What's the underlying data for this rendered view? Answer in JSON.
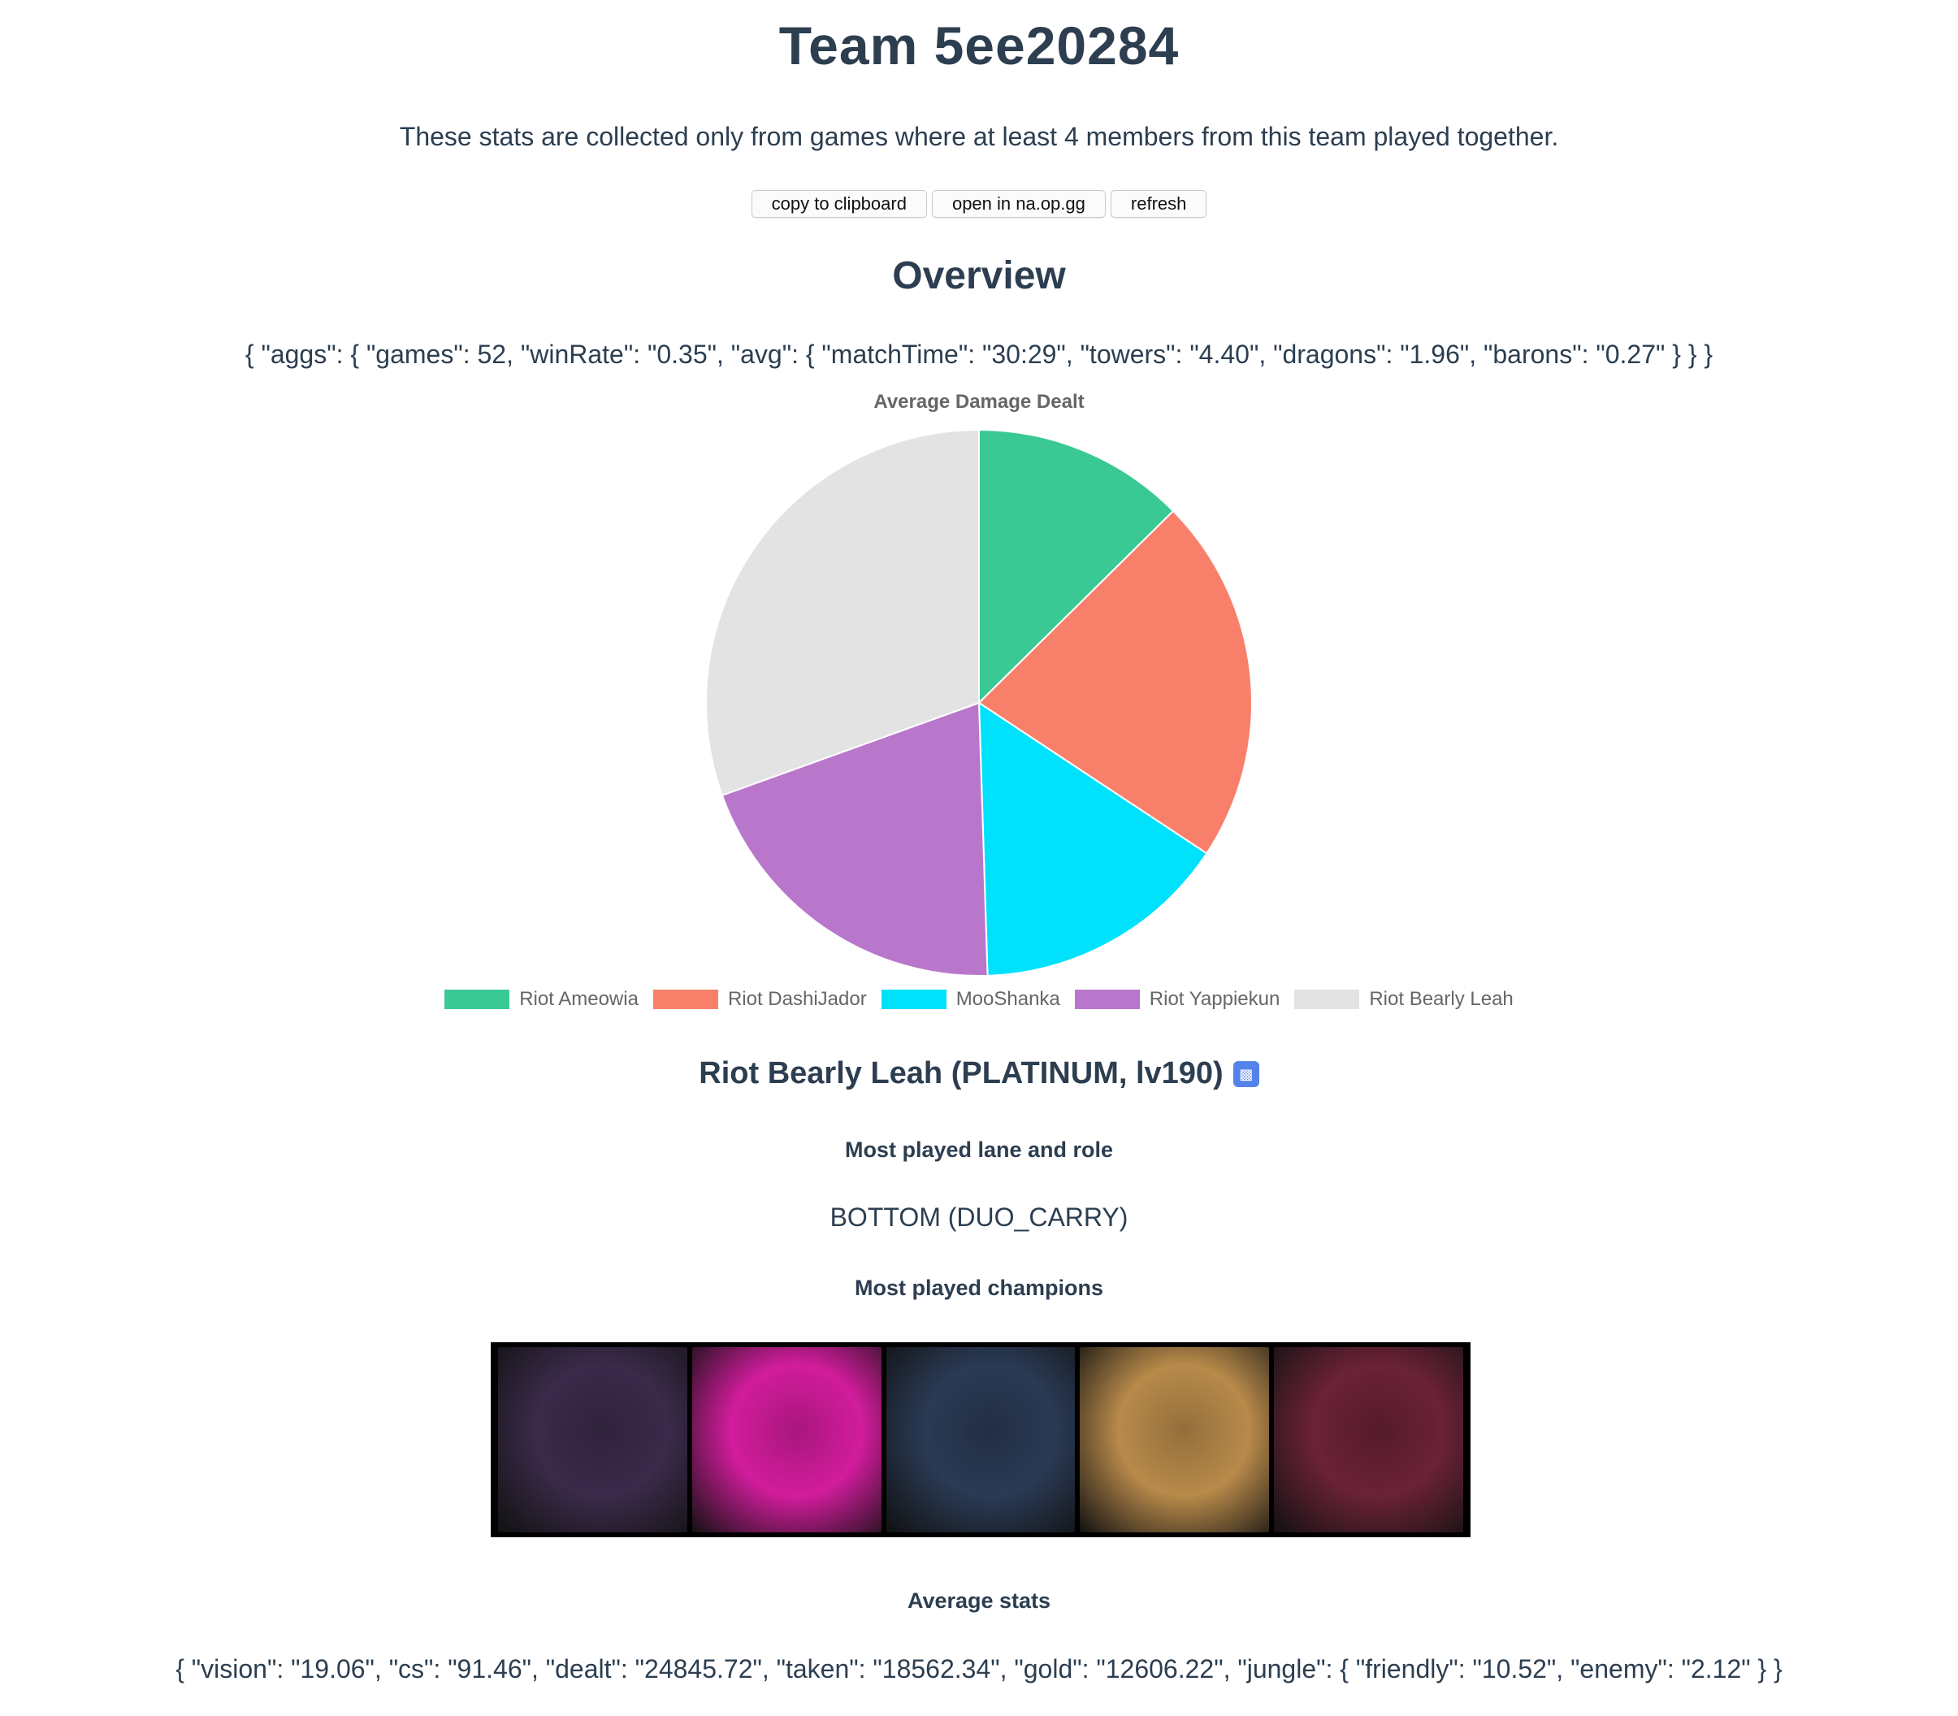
{
  "header": {
    "title": "Team 5ee20284",
    "subtitle": "These stats are collected only from games where at least 4 members from this team played together."
  },
  "toolbar": {
    "copy_label": "copy to clipboard",
    "opgg_label": "open in na.op.gg",
    "refresh_label": "refresh"
  },
  "overview": {
    "heading": "Overview",
    "json_text": "{ \"aggs\": { \"games\": 52, \"winRate\": \"0.35\", \"avg\": { \"matchTime\": \"30:29\", \"towers\": \"4.40\", \"dragons\": \"1.96\", \"barons\": \"0.27\" } } }"
  },
  "chart_data": {
    "type": "pie",
    "title": "Average Damage Dealt",
    "categories": [
      "Riot Ameowia",
      "Riot DashiJador",
      "MooShanka",
      "Riot Yappiekun",
      "Riot Bearly Leah"
    ],
    "values": [
      12.6,
      21.7,
      15.2,
      20.0,
      30.5
    ],
    "colors": [
      "#3ac994",
      "#f8806b",
      "#00e1fc",
      "#b977cc",
      "#e3e3e3"
    ],
    "legend_position": "bottom"
  },
  "player": {
    "name": "Riot Bearly Leah (PLATINUM, lv190)",
    "icon": "op-gg-icon",
    "lane_heading": "Most played lane and role",
    "lane_value": "BOTTOM (DUO_CARRY)",
    "champions_heading": "Most played champions",
    "champion_colors": [
      "#3b2a4a",
      "#d21c9c",
      "#2a3a55",
      "#b88a4a",
      "#6b2236"
    ],
    "stats_heading": "Average stats",
    "stats_json": "{ \"vision\": \"19.06\", \"cs\": \"91.46\", \"dealt\": \"24845.72\", \"taken\": \"18562.34\", \"gold\": \"12606.22\", \"jungle\": { \"friendly\": \"10.52\", \"enemy\": \"2.12\" } }"
  }
}
